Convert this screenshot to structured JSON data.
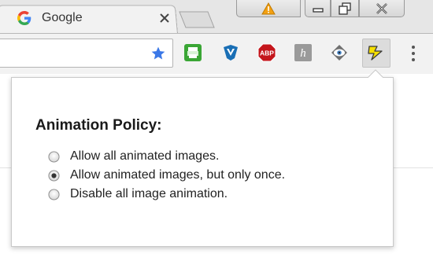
{
  "browser": {
    "tab": {
      "title": "Google",
      "favicon": "google-g-icon",
      "close": "close-icon"
    },
    "window_controls": [
      "warning-icon",
      "minimize-icon",
      "restore-icon",
      "close-icon"
    ]
  },
  "toolbar": {
    "bookmark": "star-icon",
    "extensions": [
      {
        "name": "print-icon",
        "color": "#3aa635"
      },
      {
        "name": "v-shield-icon",
        "color": "#1a6fb5"
      },
      {
        "name": "adblock-plus-icon",
        "color": "#c4161c",
        "label": "ABP"
      },
      {
        "name": "hypothesis-icon",
        "color": "#9a9a9a",
        "label": "h"
      },
      {
        "name": "eye-icon",
        "color": "#6e6e6e"
      },
      {
        "name": "lightning-icon",
        "color": "#f6e000"
      }
    ],
    "menu": "vertical-dots-icon"
  },
  "popup": {
    "title": "Animation Policy:",
    "options": [
      {
        "label": "Allow all animated images.",
        "selected": false
      },
      {
        "label": "Allow animated images, but only once.",
        "selected": true
      },
      {
        "label": "Disable all image animation.",
        "selected": false
      }
    ]
  }
}
